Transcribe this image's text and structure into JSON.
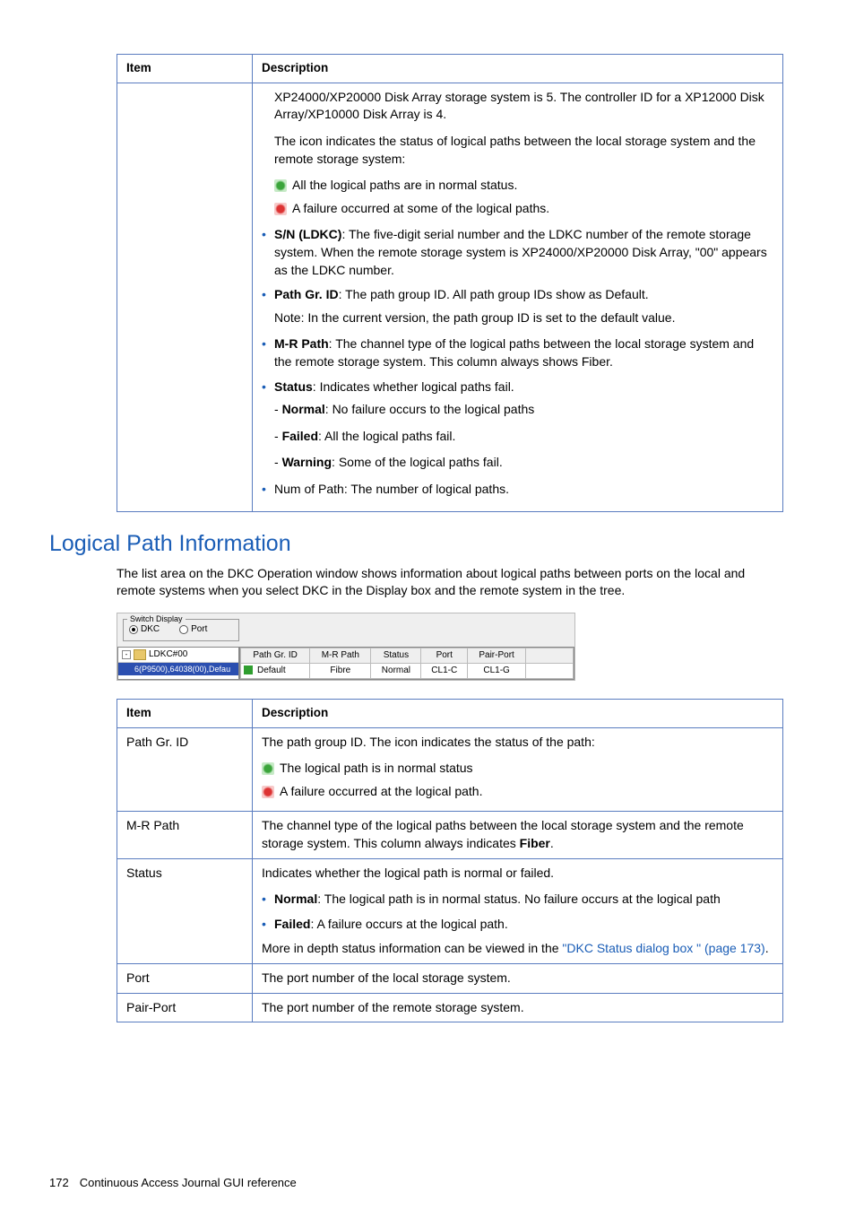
{
  "table1": {
    "headers": {
      "item": "Item",
      "desc": "Description"
    },
    "desc_intro1": "XP24000/XP20000 Disk Array storage system is 5. The controller ID for a XP12000 Disk Array/XP10000 Disk Array is 4.",
    "desc_intro2": "The icon indicates the status of logical paths between the local storage system and the remote storage system:",
    "status_ok": "All the logical paths are in normal status.",
    "status_fail": "A failure occurred at some of the logical paths.",
    "sn_bold": "S/N (LDKC)",
    "sn_text": ": The five-digit serial number and the LDKC number of the remote storage system. When the remote storage system is XP24000/XP20000 Disk Array, \"00\" appears as the LDKC number.",
    "pathgr_bold": "Path Gr. ID",
    "pathgr_text": ": The path group ID. All path group IDs show as Default.",
    "pathgr_note": "Note: In the current version, the path group ID is set to the default value.",
    "mrpath_bold": "M-R Path",
    "mrpath_text": ": The channel type of the logical paths between the local storage system and the remote storage system. This column always shows Fiber.",
    "status_bold": "Status",
    "status_text": ": Indicates whether logical paths fail.",
    "normal_bold": "Normal",
    "normal_text": ": No failure occurs to the logical paths",
    "failed_bold": "Failed",
    "failed_text": ": All the logical paths fail.",
    "warning_bold": "Warning",
    "warning_text": ": Some of the logical paths fail.",
    "numpath": "Num of Path: The number of logical paths."
  },
  "section_title": "Logical Path Information",
  "section_intro": "The list area on the DKC Operation window shows information about logical paths between ports on the local and remote systems when you select DKC in the Display box and the remote system in the tree.",
  "screenshot": {
    "switch_legend": "Switch Display",
    "radio_dkc": "DKC",
    "radio_port": "Port",
    "tree_root": "LDKC#00",
    "tree_leaf": "6(P9500),64038(00),Defau",
    "grid_headers": [
      "Path Gr. ID",
      "M-R Path",
      "Status",
      "Port",
      "Pair-Port"
    ],
    "grid_row": [
      "Default",
      "Fibre",
      "Normal",
      "CL1-C",
      "CL1-G"
    ]
  },
  "table2": {
    "headers": {
      "item": "Item",
      "desc": "Description"
    },
    "rows": {
      "pathgr": {
        "item": "Path Gr. ID",
        "line1": "The path group ID. The icon indicates the status of the path:",
        "ok": "The logical path is in normal status",
        "fail": "A failure occurred at the logical path."
      },
      "mrpath": {
        "item": "M-R Path",
        "text_a": "The channel type of the logical paths between the local storage system and the remote storage system. This column always indicates ",
        "text_bold": "Fiber",
        "text_b": "."
      },
      "status": {
        "item": "Status",
        "line1": "Indicates whether the logical path is normal or failed.",
        "normal_bold": "Normal",
        "normal_text": ": The logical path is in normal status. No failure occurs at the logical path",
        "failed_bold": "Failed",
        "failed_text": ": A failure occurs at the logical path.",
        "more_a": "More in depth status information can be viewed in the ",
        "link": "\"DKC Status dialog box \" (page 173)",
        "more_b": "."
      },
      "port": {
        "item": "Port",
        "text": "The port number of the local storage system."
      },
      "pairport": {
        "item": "Pair-Port",
        "text": "The port number of the remote storage system."
      }
    }
  },
  "footer": {
    "page": "172",
    "title": "Continuous Access Journal GUI reference"
  }
}
